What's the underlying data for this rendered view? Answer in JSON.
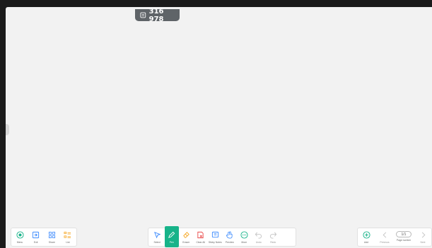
{
  "room": {
    "code": "316 978"
  },
  "toolbar_left": {
    "items": [
      {
        "label": "Menu"
      },
      {
        "label": "Exit"
      },
      {
        "label": "Share"
      },
      {
        "label": "List"
      }
    ]
  },
  "toolbar_middle": {
    "items": [
      {
        "label": "Select"
      },
      {
        "label": "Pen"
      },
      {
        "label": "Eraser"
      },
      {
        "label": "Clear All"
      },
      {
        "label": "Sticky Notes"
      },
      {
        "label": "Preview"
      },
      {
        "label": "More"
      },
      {
        "label": "Undo"
      },
      {
        "label": "Redo"
      }
    ]
  },
  "toolbar_right": {
    "add_label": "Add",
    "previous_label": "Previous",
    "page_number_value": "1/1",
    "page_number_label": "Page number",
    "next_label": "Next"
  },
  "colors": {
    "accent": "#17b389",
    "red": "#e94b4b",
    "orange": "#f5a623",
    "blue": "#3d8bfd"
  }
}
